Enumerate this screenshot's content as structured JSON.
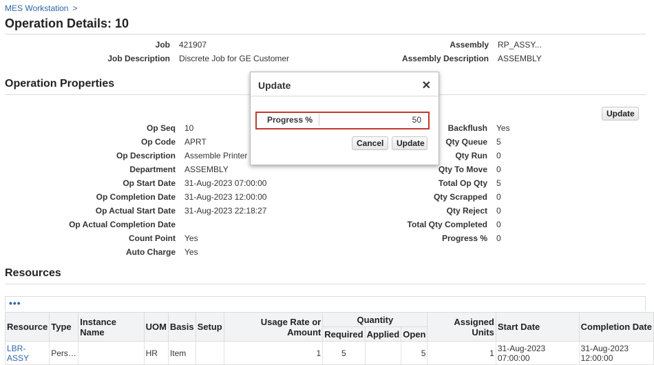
{
  "breadcrumb": {
    "link": "MES Workstation",
    "separator": ">"
  },
  "page_title": "Operation Details: 10",
  "header": {
    "job_label": "Job",
    "job_value": "421907",
    "job_desc_label": "Job Description",
    "job_desc_value": "Discrete Job for GE Customer",
    "assembly_label": "Assembly",
    "assembly_value": "RP_ASSY...",
    "assembly_desc_label": "Assembly Description",
    "assembly_desc_value": "ASSEMBLY"
  },
  "operation_properties": {
    "title": "Operation Properties",
    "update_button": "Update",
    "left": [
      {
        "label": "Op Seq",
        "value": "10"
      },
      {
        "label": "Op Code",
        "value": "APRT"
      },
      {
        "label": "Op Description",
        "value": "Assemble Printer"
      },
      {
        "label": "Department",
        "value": "ASSEMBLY"
      },
      {
        "label": "Op Start Date",
        "value": "31-Aug-2023 07:00:00"
      },
      {
        "label": "Op Completion Date",
        "value": "31-Aug-2023 12:00:00"
      },
      {
        "label": "Op Actual Start Date",
        "value": "31-Aug-2023 22:18:27"
      },
      {
        "label": "Op Actual Completion Date",
        "value": ""
      },
      {
        "label": "Count Point",
        "value": "Yes"
      },
      {
        "label": "Auto Charge",
        "value": "Yes"
      }
    ],
    "right": [
      {
        "label": "Backflush",
        "value": "Yes"
      },
      {
        "label": "Qty Queue",
        "value": "5"
      },
      {
        "label": "Qty Run",
        "value": "0"
      },
      {
        "label": "Qty To Move",
        "value": "0"
      },
      {
        "label": "Total Op Qty",
        "value": "5"
      },
      {
        "label": "Qty Scrapped",
        "value": "0"
      },
      {
        "label": "Qty Reject",
        "value": "0"
      },
      {
        "label": "Total Qty Completed",
        "value": "0"
      },
      {
        "label": "Progress %",
        "value": "0"
      }
    ]
  },
  "dialog": {
    "title": "Update",
    "close_glyph": "✕",
    "progress_label": "Progress %",
    "progress_value": "50",
    "cancel_button": "Cancel",
    "update_button": "Update"
  },
  "resources": {
    "title": "Resources",
    "toolbar_dots": "•••",
    "headers": {
      "resource": "Resource",
      "type": "Type",
      "instance_name": "Instance Name",
      "uom": "UOM",
      "basis": "Basis",
      "setup": "Setup",
      "usage_rate": "Usage Rate or Amount",
      "quantity": "Quantity",
      "required": "Required",
      "applied": "Applied",
      "open": "Open",
      "assigned_units": "Assigned Units",
      "start_date": "Start Date",
      "completion_date": "Completion Date"
    },
    "rows": [
      {
        "resource": "LBR-ASSY",
        "type": "Pers…",
        "instance_name": "",
        "uom": "HR",
        "basis": "Item",
        "setup": "",
        "usage_rate": "1",
        "required": "5",
        "applied": "",
        "open": "5",
        "assigned_units": "1",
        "start_date": "31-Aug-2023 07:00:00",
        "completion_date": "31-Aug-2023 12:00:00"
      }
    ]
  }
}
